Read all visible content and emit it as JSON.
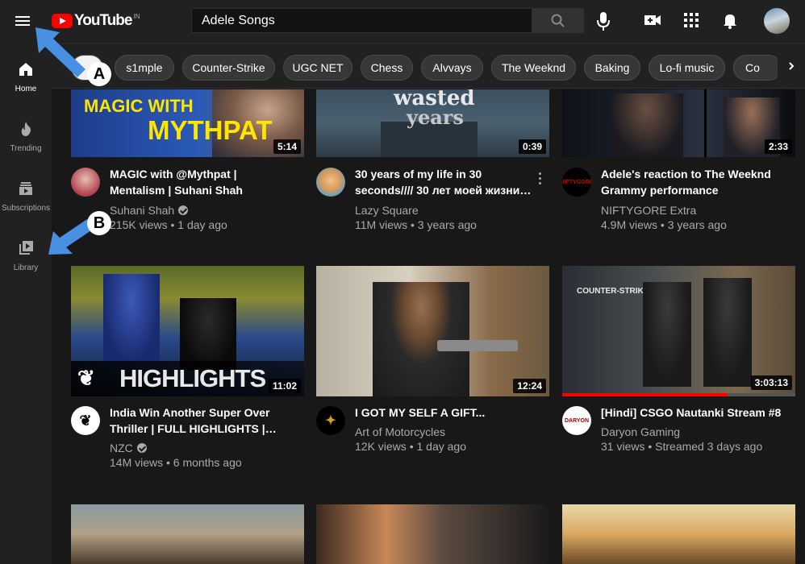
{
  "app": {
    "logo_text": "YouTube",
    "country": "IN"
  },
  "header": {
    "search_value": "Adele Songs",
    "icons": [
      "menu-icon",
      "search-icon",
      "mic-icon",
      "create-video-icon",
      "apps-grid-icon",
      "bell-icon"
    ]
  },
  "sidebar": {
    "items": [
      {
        "label": "Home",
        "icon": "home-icon"
      },
      {
        "label": "Trending",
        "icon": "flame-icon"
      },
      {
        "label": "Subscriptions",
        "icon": "subscriptions-icon"
      },
      {
        "label": "Library",
        "icon": "library-icon"
      }
    ]
  },
  "chips": [
    "s1mple",
    "Counter-Strike",
    "UGC NET",
    "Chess",
    "Alvvays",
    "The Weeknd",
    "Baking",
    "Lo-fi music",
    "Co"
  ],
  "videos": [
    {
      "title": "MAGIC with @Mythpat | Mentalism | Suhani Shah",
      "channel": "Suhani Shah",
      "verified": true,
      "meta": "215K views • 1 day ago",
      "duration": "5:14",
      "thumb_text_1": "MAGIC WITH",
      "thumb_text_2": "MYTHPAT"
    },
    {
      "title": "30 years of my life in 30 seconds//// 30 лет моей жизни…",
      "channel": "Lazy Square",
      "verified": false,
      "meta": "11M views • 3 years ago",
      "duration": "0:39",
      "thumb_text_1": "wasted",
      "thumb_text_2": "years"
    },
    {
      "title": "Adele's reaction to The Weeknd Grammy performance",
      "channel": "NIFTYGORE Extra",
      "verified": false,
      "meta": "4.9M views • 3 years ago",
      "duration": "2:33",
      "avatar_text": "NIFTYGORE"
    },
    {
      "title": "India Win Another Super Over Thriller | FULL HIGHLIGHTS |…",
      "channel": "NZC",
      "verified": true,
      "meta": "14M views • 6 months ago",
      "duration": "11:02",
      "thumb_text_1": "HIGHLIGHTS"
    },
    {
      "title": "I GOT MY SELF A GIFT...",
      "channel": "Art of Motorcycles",
      "verified": false,
      "meta": "12K views • 1 day ago",
      "duration": "12:24"
    },
    {
      "title": "[Hindi] CSGO Nautanki Stream #8",
      "channel": "Daryon Gaming",
      "verified": false,
      "meta": "31 views • Streamed 3 days ago",
      "duration": "3:03:13",
      "watched_fraction": 0.71,
      "thumb_text_1": "COUNTER-STRIKE",
      "avatar_text": "DARYON"
    }
  ],
  "annotations": [
    {
      "label": "A",
      "color": "#4a90e2"
    },
    {
      "label": "B",
      "color": "#4a90e2"
    }
  ],
  "colors": {
    "background": "#181818",
    "chrome": "#212121",
    "brand": "#ff0000",
    "annotation": "#4a90e2"
  }
}
